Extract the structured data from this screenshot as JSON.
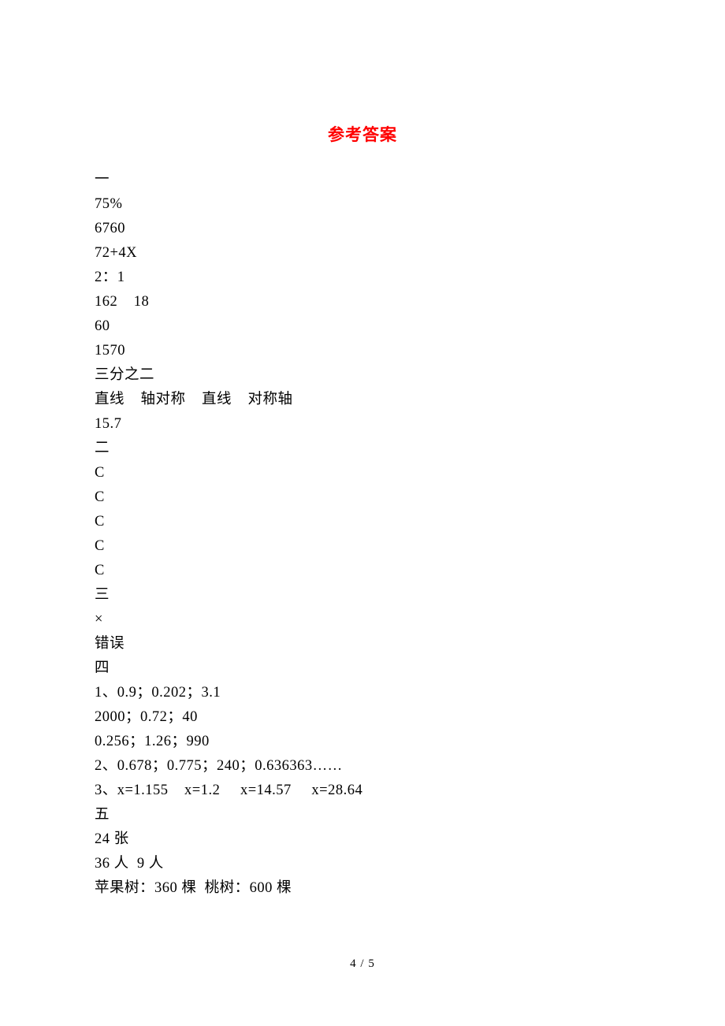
{
  "title": "参考答案",
  "lines": {
    "l0": "一",
    "l1": "75%",
    "l2": "6760",
    "l3": "72+4X",
    "l4": "2：1",
    "l5": "162    18",
    "l6": "60",
    "l7": "1570",
    "l8": "三分之二",
    "l9": "直线    轴对称    直线    对称轴",
    "l10": "15.7",
    "l11": "二",
    "l12": "C",
    "l13": "C",
    "l14": "C",
    "l15": "C",
    "l16": "C",
    "l17": "三",
    "l18": "×",
    "l19": "错误",
    "l20": "四",
    "l21": "1、0.9；0.202；3.1",
    "l22": "2000；0.72；40",
    "l23": "0.256；1.26；990",
    "l24": "2、0.678；0.775；240；0.636363……",
    "l25": "3、x=1.155    x=1.2     x=14.57     x=28.64",
    "l26": "五",
    "l27": "24 张",
    "l28": "36 人  9 人",
    "l29": "苹果树：360 棵  桃树：600 棵"
  },
  "footer": "4 / 5"
}
